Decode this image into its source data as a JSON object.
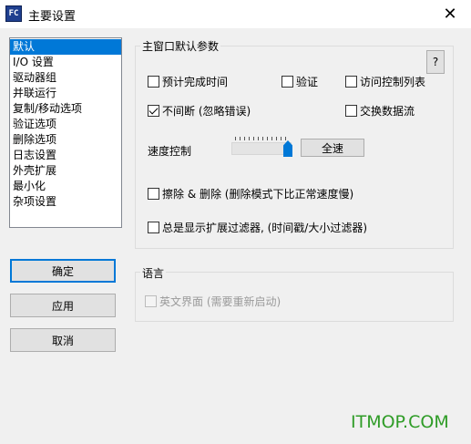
{
  "window": {
    "title": "主要设置",
    "app_icon_text": "FC",
    "close_glyph": "✕"
  },
  "sidebar": {
    "items": [
      {
        "label": "默认",
        "selected": true
      },
      {
        "label": "I/O 设置"
      },
      {
        "label": "驱动器组"
      },
      {
        "label": "并联运行"
      },
      {
        "label": "复制/移动选项"
      },
      {
        "label": "验证选项"
      },
      {
        "label": "删除选项"
      },
      {
        "label": "日志设置"
      },
      {
        "label": "外壳扩展"
      },
      {
        "label": "最小化"
      },
      {
        "label": "杂项设置"
      }
    ]
  },
  "buttons": {
    "ok": "确定",
    "apply": "应用",
    "cancel": "取消"
  },
  "main_group": {
    "title": "主窗口默认参数",
    "help": "?",
    "options": {
      "estimate_time": {
        "label": "预计完成时间",
        "checked": false
      },
      "verify": {
        "label": "验证",
        "checked": false
      },
      "acl_list": {
        "label": "访问控制列表",
        "checked": false
      },
      "nonstop": {
        "label": "不间断 (忽略错误)",
        "checked": true
      },
      "exchange_stream": {
        "label": "交换数据流",
        "checked": false
      },
      "erase_delete": {
        "label": "擦除 & 删除 (删除模式下比正常速度慢)",
        "checked": false
      },
      "always_show_filter": {
        "label": "总是显示扩展过滤器, (时间戳/大小过滤器)",
        "checked": false
      }
    },
    "speed": {
      "label": "速度控制",
      "level": 1.0,
      "button": "全速"
    }
  },
  "language_group": {
    "title": "语言",
    "english_ui": {
      "label": "英文界面 (需要重新启动)",
      "checked": false,
      "disabled": true
    }
  },
  "watermark": "ITMOP.COM",
  "colors": {
    "selection": "#0078d7",
    "watermark": "#2f9c27"
  }
}
